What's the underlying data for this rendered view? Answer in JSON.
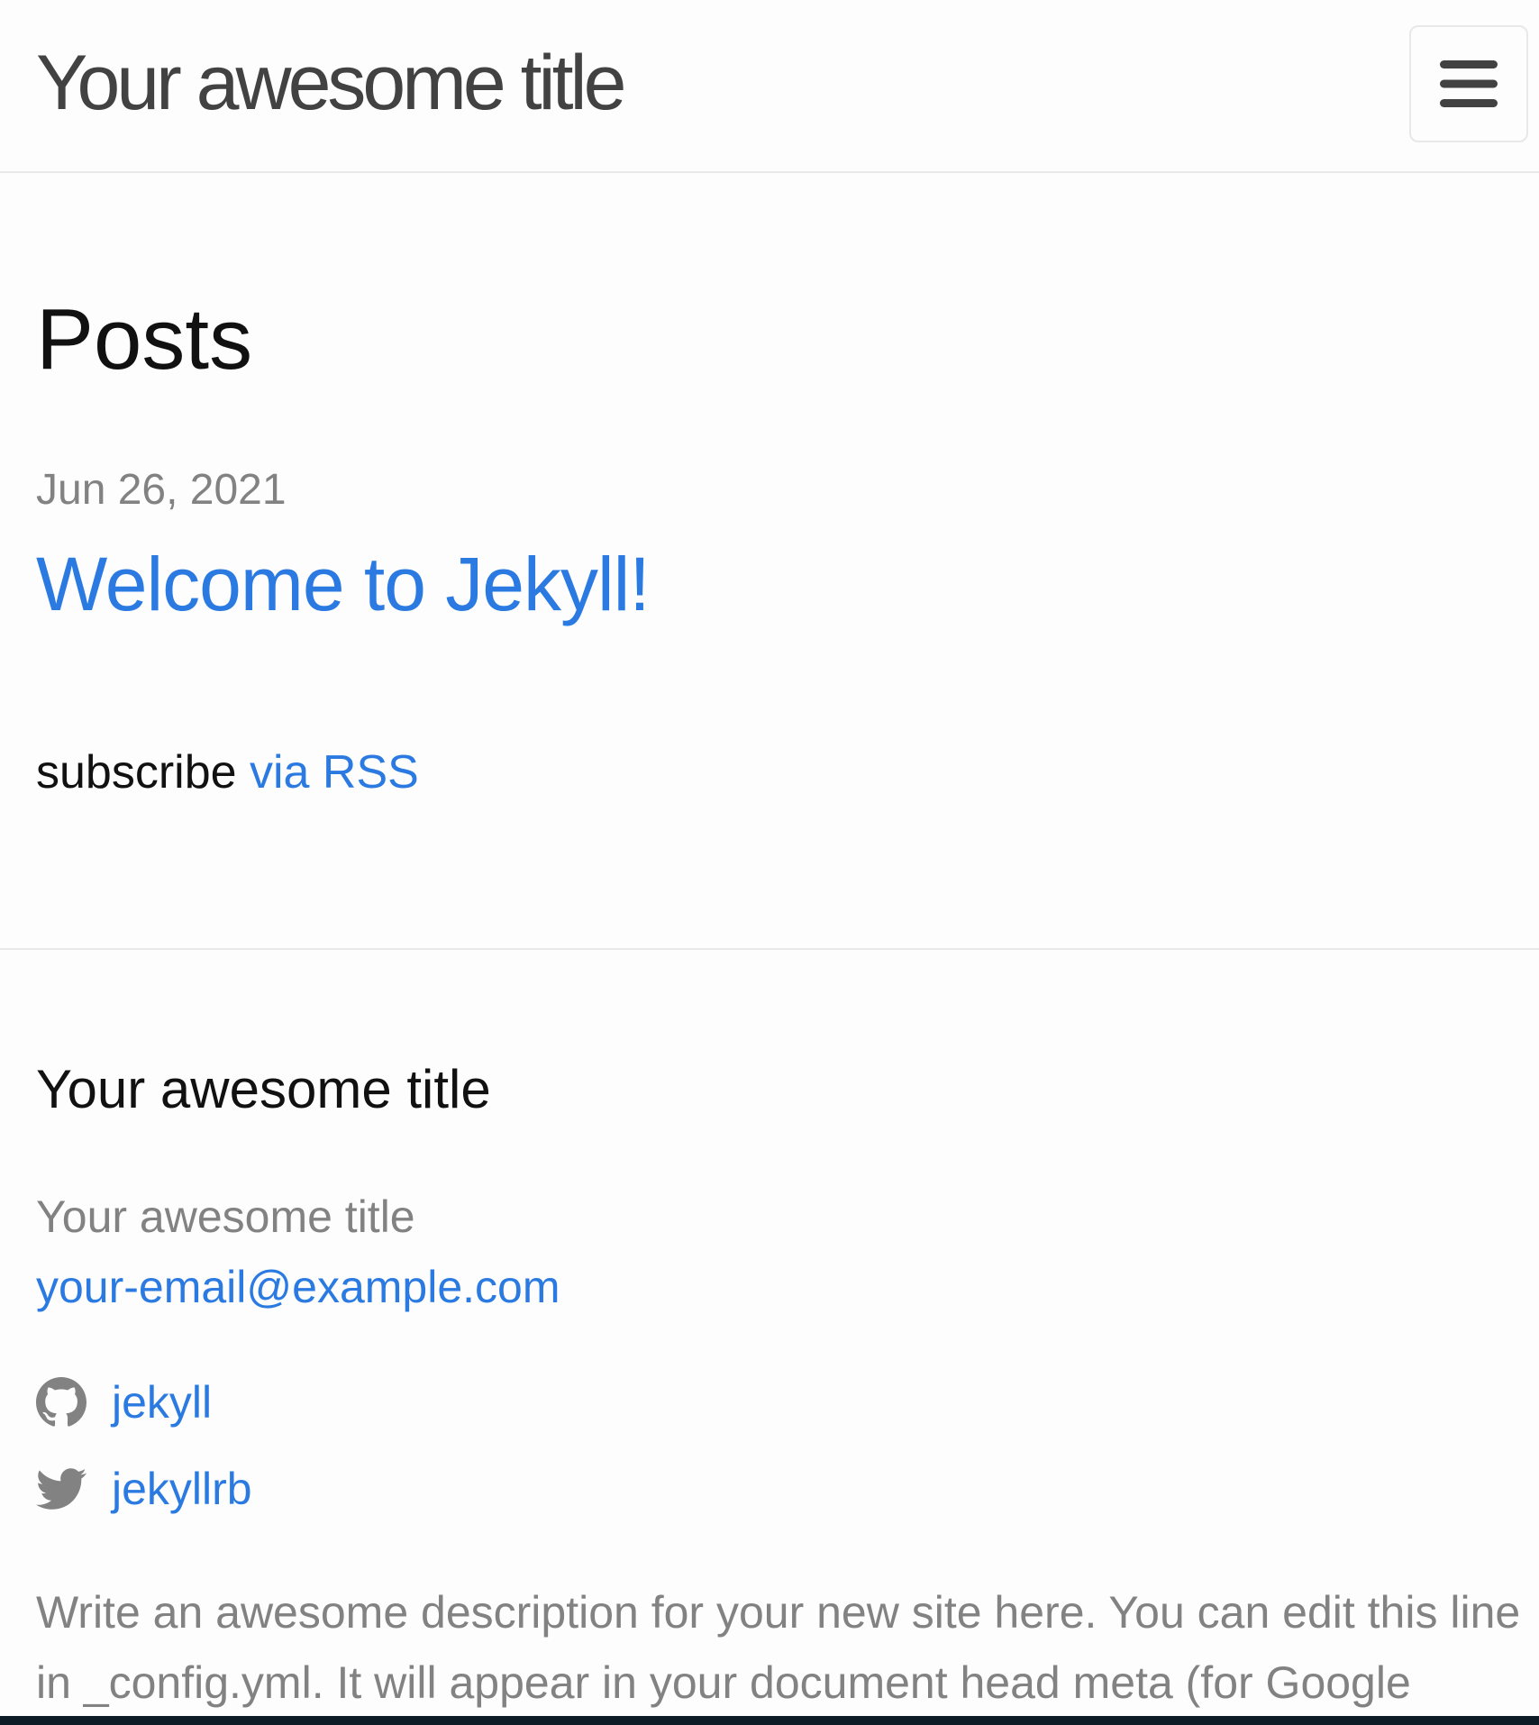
{
  "header": {
    "site_title": "Your awesome title",
    "menu_icon": "hamburger-menu-icon"
  },
  "main": {
    "heading": "Posts",
    "posts": [
      {
        "date": "Jun 26, 2021",
        "title": "Welcome to Jekyll!"
      }
    ],
    "rss": {
      "prefix": "subscribe ",
      "link_label": "via RSS"
    }
  },
  "footer": {
    "heading": "Your awesome title",
    "name": "Your awesome title",
    "email": "your-email@example.com",
    "social": [
      {
        "icon": "github-icon",
        "handle": "jekyll"
      },
      {
        "icon": "twitter-icon",
        "handle": "jekyllrb"
      }
    ],
    "description": "Write an awesome description for your new site here. You can edit this line in _config.yml. It will appear in your document head meta (for Google"
  },
  "colors": {
    "link": "#2a7ae2",
    "muted": "#828282",
    "text": "#111111",
    "border": "#e8e8e8",
    "background": "#fdfdfd"
  }
}
